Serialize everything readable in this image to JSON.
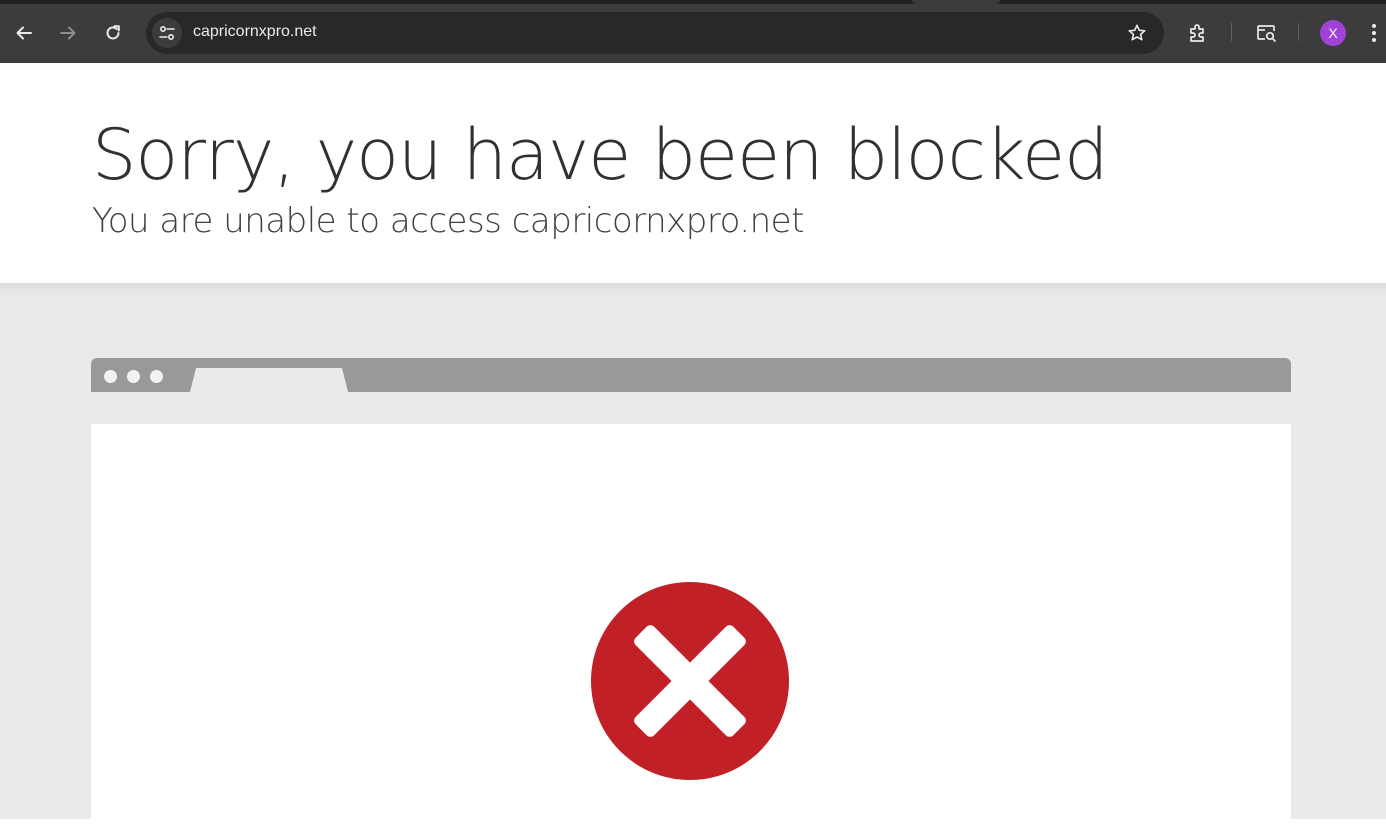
{
  "browser": {
    "url": "capricornxpro.net",
    "profile_initial": "X",
    "icons": [
      "back-arrow-icon",
      "forward-arrow-icon",
      "reload-icon",
      "site-info-icon",
      "star-icon",
      "extensions-icon",
      "tab-search-icon",
      "more-vert-icon"
    ],
    "profile_color": "#a142d6"
  },
  "page": {
    "title": "Sorry, you have been blocked",
    "subtitle": "You are unable to access capricornxpro.net",
    "error_icon": "error-x-circle-icon",
    "error_color": "#c12126"
  }
}
